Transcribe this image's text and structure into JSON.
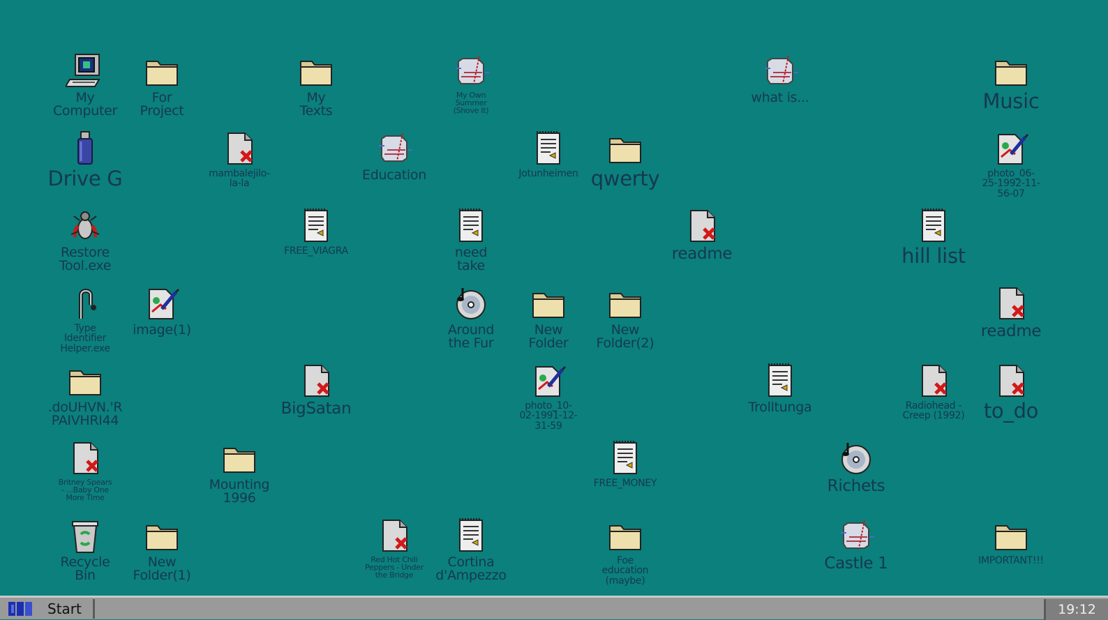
{
  "desktop_icons": [
    {
      "label": "My\nComputer",
      "icon": "computer-icon",
      "size": "m",
      "pos": "c1r1"
    },
    {
      "label": "For\nProject",
      "icon": "folder-icon",
      "size": "m",
      "pos": "c2r1"
    },
    {
      "label": "My\nTexts",
      "icon": "folder-icon",
      "size": "m",
      "pos": "c4r1"
    },
    {
      "label": "My Own\nSummer\n(Shove It)",
      "icon": "corrupted-file-icon",
      "size": "xs",
      "pos": "c6r1"
    },
    {
      "label": "what is...",
      "icon": "corrupted-file-icon",
      "size": "m",
      "pos": "c10r1"
    },
    {
      "label": "Music",
      "icon": "folder-icon",
      "size": "xl",
      "pos": "c13r1"
    },
    {
      "label": "Drive G",
      "icon": "usb-drive-icon",
      "size": "xl",
      "pos": "c1r2"
    },
    {
      "label": "mambalejilo-\nla-la",
      "icon": "missing-file-icon",
      "size": "s",
      "pos": "c3r2"
    },
    {
      "label": "Education",
      "icon": "corrupted-file-icon",
      "size": "m",
      "pos": "c5r2"
    },
    {
      "label": "Jotunheimen",
      "icon": "text-document-icon",
      "size": "s",
      "pos": "c7r2"
    },
    {
      "label": "qwerty",
      "icon": "folder-icon",
      "size": "xl",
      "pos": "c8r2"
    },
    {
      "label": "photo_06-\n25-1992-11-\n56-07",
      "icon": "image-file-icon",
      "size": "s",
      "pos": "c13r2"
    },
    {
      "label": "Restore\nTool.exe",
      "icon": "bug-icon",
      "size": "m",
      "pos": "c1r3"
    },
    {
      "label": "FREE_VIAGRA",
      "icon": "text-document-icon",
      "size": "s",
      "pos": "c4r3"
    },
    {
      "label": "need\ntake",
      "icon": "text-document-icon",
      "size": "m",
      "pos": "c6r3"
    },
    {
      "label": "readme",
      "icon": "missing-file-icon",
      "size": "l",
      "pos": "c9r3"
    },
    {
      "label": "hill list",
      "icon": "text-document-icon",
      "size": "xl",
      "pos": "c12r3"
    },
    {
      "label": "Type\nIdentifier\nHelper.exe",
      "icon": "hook-icon",
      "size": "s",
      "pos": "c1r4"
    },
    {
      "label": "image(1)",
      "icon": "image-file-icon",
      "size": "m",
      "pos": "c2r4"
    },
    {
      "label": "Around\nthe Fur",
      "icon": "music-cd-icon",
      "size": "m",
      "pos": "c6r4"
    },
    {
      "label": "New\nFolder",
      "icon": "folder-icon",
      "size": "m",
      "pos": "c7r4"
    },
    {
      "label": "New\nFolder(2)",
      "icon": "folder-icon",
      "size": "m",
      "pos": "c8r4"
    },
    {
      "label": "readme",
      "icon": "missing-file-icon",
      "size": "l",
      "pos": "c13r4"
    },
    {
      "label": ".doUHVN.'R\nPAIVHRI44",
      "icon": "folder-icon",
      "size": "m",
      "pos": "c1r5"
    },
    {
      "label": "BigSatan",
      "icon": "missing-file-icon",
      "size": "l",
      "pos": "c4r5"
    },
    {
      "label": "photo_10-\n02-1991-12-\n31-59",
      "icon": "image-file-icon",
      "size": "s",
      "pos": "c7r5"
    },
    {
      "label": "Trolltunga",
      "icon": "text-document-icon",
      "size": "m",
      "pos": "c10r5"
    },
    {
      "label": "Radiohead -\nCreep (1992)",
      "icon": "missing-file-icon",
      "size": "s",
      "pos": "c12r5"
    },
    {
      "label": "to_do",
      "icon": "missing-file-icon",
      "size": "xl",
      "pos": "c13r5"
    },
    {
      "label": "Britney Spears\n- ...Baby One\nMore Time",
      "icon": "missing-file-icon",
      "size": "xs",
      "pos": "c1r6"
    },
    {
      "label": "Mounting\n1996",
      "icon": "folder-icon",
      "size": "m",
      "pos": "c3r6"
    },
    {
      "label": "FREE_MONEY",
      "icon": "text-document-icon",
      "size": "s",
      "pos": "c8r6"
    },
    {
      "label": "Richets",
      "icon": "music-cd-icon",
      "size": "l",
      "pos": "c11r6"
    },
    {
      "label": "Recycle\nBin",
      "icon": "recycle-bin-icon",
      "size": "m",
      "pos": "c1r7"
    },
    {
      "label": "New\nFolder(1)",
      "icon": "folder-icon",
      "size": "m",
      "pos": "c2r7"
    },
    {
      "label": "Red Hot Chili\nPeppers - Under\nthe Bridge",
      "icon": "missing-file-icon",
      "size": "xs",
      "pos": "c5r7"
    },
    {
      "label": "Cortina\nd'Ampezzo",
      "icon": "text-document-icon",
      "size": "m",
      "pos": "c6r7"
    },
    {
      "label": "Foe\neducation\n(maybe)",
      "icon": "folder-icon",
      "size": "s",
      "pos": "c8r7"
    },
    {
      "label": "Castle 1",
      "icon": "corrupted-file-icon",
      "size": "l",
      "pos": "c11r7"
    },
    {
      "label": "IMPORTANT!!!",
      "icon": "folder-icon",
      "size": "s",
      "pos": "c13r7"
    }
  ],
  "taskbar": {
    "start_label": "Start",
    "clock": "19:12"
  },
  "colors": {
    "desktop": "#0b807d",
    "label": "#15394f",
    "taskbar": "#9a9a9a"
  }
}
